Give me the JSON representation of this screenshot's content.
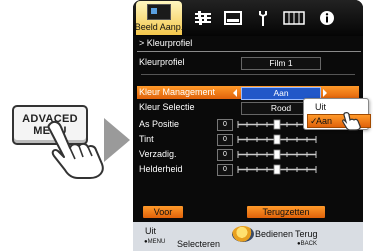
{
  "remote": {
    "line1": "ADVACED",
    "line2": "MENU"
  },
  "tabs": {
    "active_label": "Beeld Aanp.",
    "icons": [
      "picture-adjust-icon",
      "sliders-icon",
      "display-icon",
      "wrench-icon",
      "input-grid-icon",
      "info-icon"
    ]
  },
  "menu": {
    "breadcrumb": "> Kleurprofiel",
    "profile_label": "Kleurprofiel",
    "profile_value": "Film 1",
    "color_mgmt_label": "Kleur Management",
    "color_mgmt_value": "Aan",
    "color_select_label": "Kleur Selectie",
    "color_select_value": "Rood",
    "sliders": [
      {
        "label": "As Positie",
        "value": "0"
      },
      {
        "label": "Tint",
        "value": "0"
      },
      {
        "label": "Verzadig.",
        "value": "0"
      },
      {
        "label": "Helderheid",
        "value": "0"
      }
    ],
    "btn_voor": "Voor",
    "btn_terug": "Terugzetten"
  },
  "popup": {
    "options": [
      "Uit",
      "Aan"
    ],
    "selected": "Aan"
  },
  "footer": {
    "exit": "Uit",
    "exit_sub": "●MENU",
    "select": "Selecteren",
    "operate": "Bedienen",
    "back": "Terug",
    "back_sub": "●BACK"
  },
  "colors": {
    "accent_orange": "#f07a1a",
    "value_blue": "#2157c8",
    "panel_bg": "#0a0a0a",
    "tab_active": "#f3c74c"
  }
}
